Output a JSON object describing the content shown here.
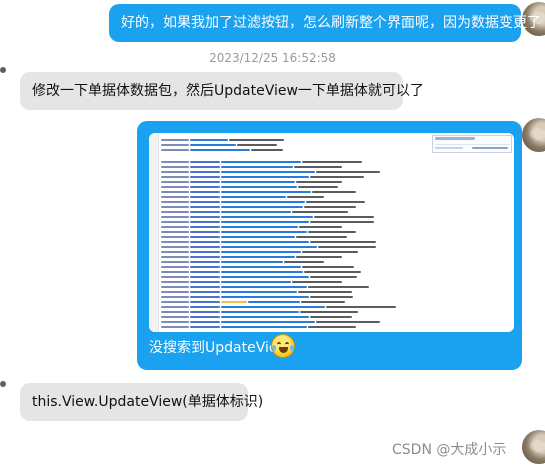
{
  "messages": [
    {
      "side": "right",
      "text": "好的，如果我加了过滤按钮，怎么刷新整个界面呢，因为数据变更了"
    },
    {
      "side": "timestamp",
      "text": "2023/12/25 16:52:58"
    },
    {
      "side": "left",
      "text": "修改一下单据体数据包，然后UpdateView一下单据体就可以了"
    },
    {
      "side": "right",
      "caption": "没搜索到UpdateView",
      "emoji": "laughing-crying-emoji"
    },
    {
      "side": "left",
      "text": "this.View.UpdateView(单据体标识)"
    }
  ],
  "watermark": "CSDN @大成小示",
  "colors": {
    "right_bubble": "#1aa1ef",
    "left_bubble": "#e5e5e5",
    "time_text": "#9a9a9a",
    "watermark_text": "#8d8d8d"
  }
}
